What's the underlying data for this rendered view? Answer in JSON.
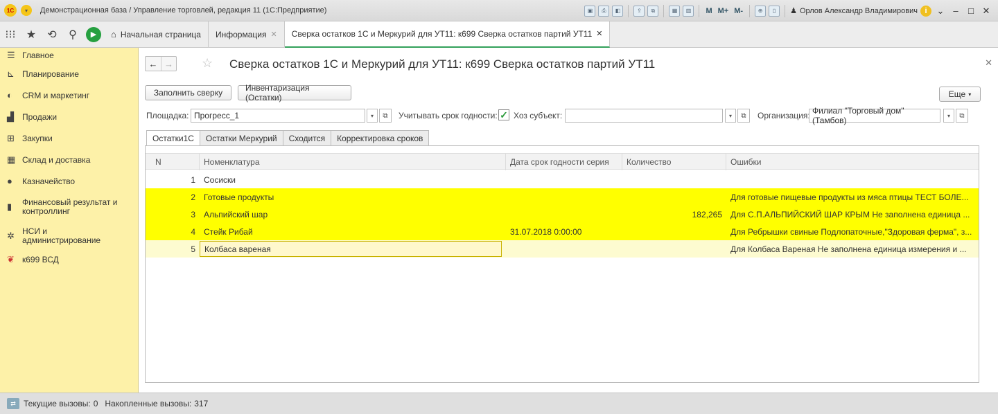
{
  "window": {
    "title": "Демонстрационная база / Управление торговлей, редакция 11  (1С:Предприятие)",
    "logo_text": "1С",
    "user": "Орлов Александр Владимирович",
    "memory_buttons": [
      "M",
      "M+",
      "M-"
    ]
  },
  "tabs": [
    {
      "label": "Начальная страница"
    },
    {
      "label": "Информация"
    },
    {
      "label": "Сверка остатков 1С и Меркурий для УТ11: к699 Сверка остатков партий УТ11"
    }
  ],
  "sidebar": {
    "items": [
      {
        "label": "Главное",
        "icon": "menu-lines-icon"
      },
      {
        "label": "Планирование",
        "icon": "planning-icon"
      },
      {
        "label": "CRM и маркетинг",
        "icon": "crm-icon"
      },
      {
        "label": "Продажи",
        "icon": "bag-icon"
      },
      {
        "label": "Закупки",
        "icon": "cart-icon"
      },
      {
        "label": "Склад и доставка",
        "icon": "warehouse-icon"
      },
      {
        "label": "Казначейство",
        "icon": "treasury-icon"
      },
      {
        "label": "Финансовый результат и контроллинг",
        "icon": "chart-icon"
      },
      {
        "label": "НСИ и администрирование",
        "icon": "gear-icon"
      },
      {
        "label": "к699 ВСД",
        "icon": "extension-icon"
      }
    ]
  },
  "form": {
    "title": "Сверка остатков 1С и Меркурий для УТ11: к699 Сверка остатков партий УТ11",
    "btn_fill": "Заполнить сверку",
    "btn_inventory": "Инвентаризация (Остатки)",
    "btn_more": "Еще",
    "site_label": "Площадка:",
    "site_value": "Прогресс_1",
    "expiry_label": "Учитывать срок годности:",
    "expiry_checked": true,
    "subject_label": "Хоз субъект:",
    "subject_value": "",
    "org_label": "Организация:",
    "org_value": "Филиал \"Торговый дом\" (Тамбов)",
    "tabs": [
      "Остатки1С",
      "Остатки Меркурий",
      "Сходится",
      "Корректировка сроков"
    ]
  },
  "grid": {
    "columns": [
      "N",
      "Номенклатура",
      "Дата срок годности серия",
      "Количество",
      "Ошибки"
    ],
    "rows": [
      {
        "n": "1",
        "nom": "Сосиски",
        "date": "",
        "qty": "",
        "err": ""
      },
      {
        "n": "2",
        "nom": "Готовые продукты",
        "date": "",
        "qty": "",
        "err": "Для готовые пищевые продукты из мяса птицы ТЕСТ БОЛЕ..."
      },
      {
        "n": "3",
        "nom": "Альпийский шар",
        "date": "",
        "qty": "182,265",
        "err": "Для С.П.АЛЬПИЙСКИЙ ШАР КРЫМ Не заполнена единица ..."
      },
      {
        "n": "4",
        "nom": "Стейк Рибай",
        "date": "31.07.2018 0:00:00",
        "qty": "",
        "err": "Для Ребрышки свиные Подлопаточные,\"Здоровая ферма\", з..."
      },
      {
        "n": "5",
        "nom": "Колбаса вареная",
        "date": "",
        "qty": "",
        "err": "Для Колбаса Вареная Не заполнена единица измерения  и ..."
      }
    ]
  },
  "status": {
    "current_calls_label": "Текущие вызовы:",
    "current_calls": "0",
    "accum_calls_label": "Накопленные вызовы:",
    "accum_calls": "317"
  }
}
